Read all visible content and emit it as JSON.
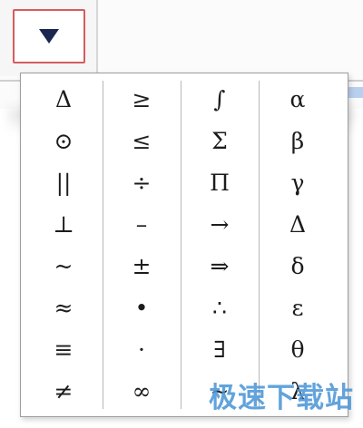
{
  "toolbar": {
    "dropdown_icon": "triangle-down-icon"
  },
  "symbol_columns": [
    {
      "symbols": [
        "Δ",
        "⊙",
        "||",
        "⊥",
        "~",
        "≈",
        "≡",
        "≠"
      ]
    },
    {
      "symbols": [
        "≥",
        "≤",
        "÷",
        "–",
        "±",
        "•",
        "·",
        "∞"
      ]
    },
    {
      "symbols": [
        "∫",
        "Σ",
        "Π",
        "→",
        "⇒",
        "∴",
        "∃",
        "∼"
      ]
    },
    {
      "symbols": [
        "α",
        "β",
        "γ",
        "Δ",
        "δ",
        "ε",
        "θ",
        "λ"
      ]
    }
  ],
  "watermark": {
    "text": "极速下载站"
  },
  "colors": {
    "dropdown_border": "#d65c5c",
    "triangle": "#1a2750",
    "watermark": "#4d97d8"
  }
}
